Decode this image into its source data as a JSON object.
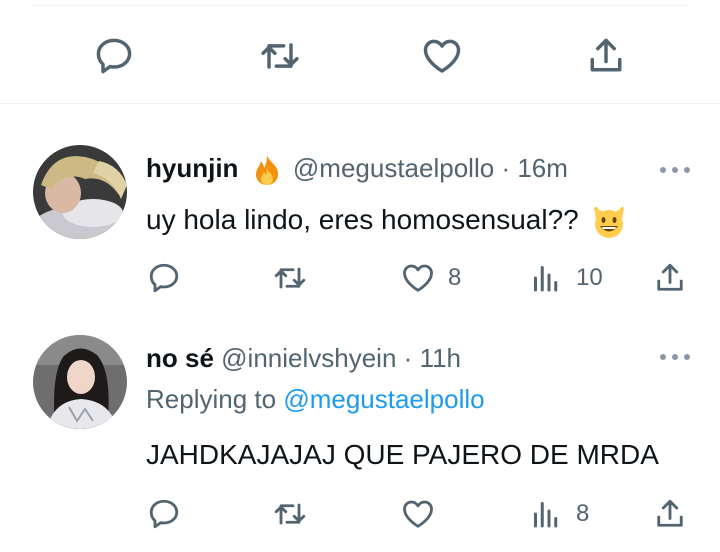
{
  "colors": {
    "text": "#0f1419",
    "secondary": "#536471",
    "link": "#1d9bf0",
    "divider": "#eff3f4"
  },
  "main_actions": [
    "reply-icon",
    "retweet-icon",
    "like-icon",
    "share-icon"
  ],
  "replies": [
    {
      "name": "hyunjin",
      "badge_emoji": "fire",
      "handle": "@megustaelpollo",
      "separator": "·",
      "time": "16m",
      "text": "uy hola lindo, eres homosensual??",
      "text_emoji": "grinning-cat",
      "replying_prefix": "",
      "replying_to": "",
      "likes": "8",
      "views": "10"
    },
    {
      "name": "no sé",
      "handle": "@innielvshyein",
      "separator": "·",
      "time": "11h",
      "replying_prefix": "Replying to",
      "replying_to": "@megustaelpollo",
      "text": "JAHDKAJAJAJ QUE PAJERO DE MRDA",
      "likes": "",
      "views": "8"
    }
  ]
}
